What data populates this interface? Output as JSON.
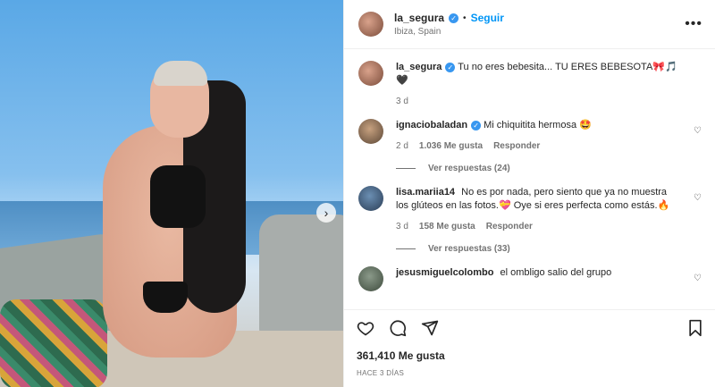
{
  "post": {
    "username": "la_segura",
    "follow_label": "Seguir",
    "location": "Ibiza, Spain",
    "separator": "•"
  },
  "caption": {
    "username": "la_segura",
    "text": "Tu no eres bebesita... TU ERES BEBESOTA🎀🎵🖤",
    "time": "3 d"
  },
  "comments": [
    {
      "username": "ignaciobaladan",
      "verified": true,
      "text": "Mi chiquitita hermosa 🤩",
      "time": "2 d",
      "likes": "1.036 Me gusta",
      "reply_label": "Responder",
      "view_replies": "Ver respuestas (24)"
    },
    {
      "username": "lisa.mariia14",
      "verified": false,
      "text": "No es por nada, pero siento que ya no muestra los glúteos en las fotos.💝 Oye si eres perfecta como estás.🔥",
      "time": "3 d",
      "likes": "158 Me gusta",
      "reply_label": "Responder",
      "view_replies": "Ver respuestas (33)"
    },
    {
      "username": "jesusmiguelcolombo",
      "verified": false,
      "text": "el ombligo salio del grupo"
    }
  ],
  "actions": {
    "likes": "361,410 Me gusta",
    "posted_ago": "HACE 3 DÍAS"
  },
  "icons": {
    "verified": "verified-badge-icon",
    "more": "more-options-icon",
    "heart": "heart-icon",
    "comment": "comment-icon",
    "share": "share-icon",
    "save": "bookmark-icon",
    "next": "chevron-right-icon"
  },
  "colors": {
    "accent": "#0095f6",
    "verified": "#3897f0",
    "muted": "#737373"
  }
}
